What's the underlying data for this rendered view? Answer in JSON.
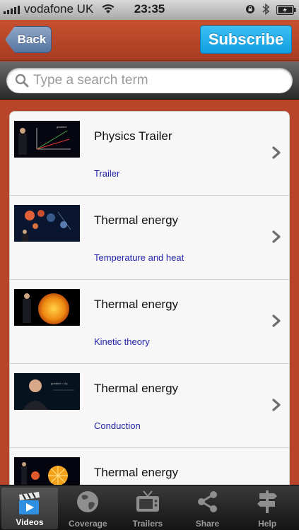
{
  "status_bar": {
    "carrier": "vodafone UK",
    "time": "23:35"
  },
  "nav": {
    "back_label": "Back",
    "subscribe_label": "Subscribe"
  },
  "search": {
    "placeholder": "Type a search term",
    "value": ""
  },
  "videos": [
    {
      "title": "Physics Trailer",
      "subtitle": "Trailer",
      "thumbnail": "graph-thumbnail"
    },
    {
      "title": "Thermal energy",
      "subtitle": "Temperature and heat",
      "thumbnail": "planets-thumbnail"
    },
    {
      "title": "Thermal energy",
      "subtitle": "Kinetic theory",
      "thumbnail": "sun-thumbnail"
    },
    {
      "title": "Thermal energy",
      "subtitle": "Conduction",
      "thumbnail": "presenter-thumbnail"
    },
    {
      "title": "Thermal energy",
      "subtitle": "",
      "thumbnail": "orbs-thumbnail"
    }
  ],
  "tabs": [
    {
      "label": "Videos",
      "icon": "clapperboard-icon",
      "active": true
    },
    {
      "label": "Coverage",
      "icon": "globe-icon",
      "active": false
    },
    {
      "label": "Trailers",
      "icon": "tv-icon",
      "active": false
    },
    {
      "label": "Share",
      "icon": "share-icon",
      "active": false
    },
    {
      "label": "Help",
      "icon": "signpost-icon",
      "active": false
    }
  ],
  "colors": {
    "nav_background": "#b8442a",
    "subscribe": "#1aa6e8",
    "back": "#6f8bb4",
    "subtitle_link": "#2222aa"
  }
}
